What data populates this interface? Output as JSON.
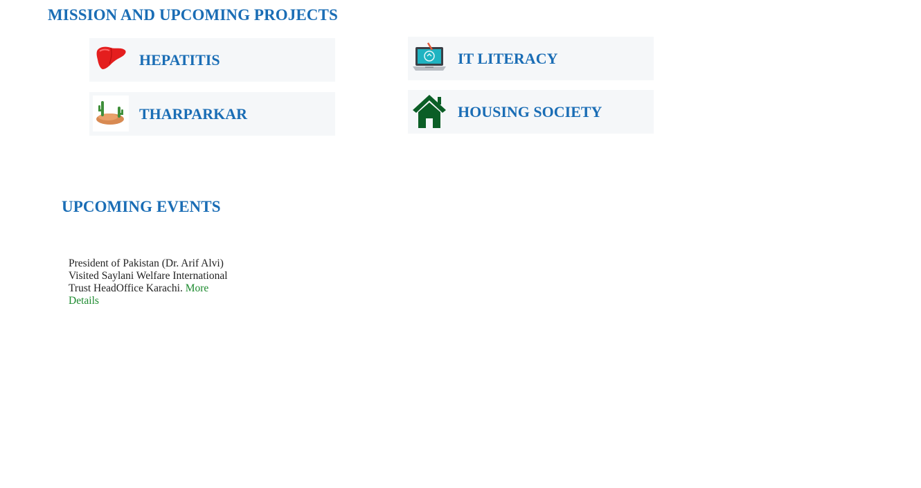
{
  "mission": {
    "title": "MISSION AND UPCOMING PROJECTS",
    "cards": [
      {
        "label": "HEPATITIS",
        "icon": "liver-icon"
      },
      {
        "label": "THARPARKAR",
        "icon": "desert-cactus-icon"
      },
      {
        "label": "IT LITERACY",
        "icon": "laptop-icon"
      },
      {
        "label": "HOUSING SOCIETY",
        "icon": "house-icon"
      }
    ]
  },
  "events": {
    "title": "UPCOMING EVENTS",
    "items": [
      {
        "text": "President of Pakistan (Dr. Arif Alvi) Visited Saylani Welfare International Trust HeadOffice Karachi.",
        "link": "More Details"
      }
    ]
  },
  "colors": {
    "heading": "#1a6db5",
    "card_bg": "#f5f7f9",
    "link": "#1c8a2e",
    "body_text": "#222222"
  }
}
